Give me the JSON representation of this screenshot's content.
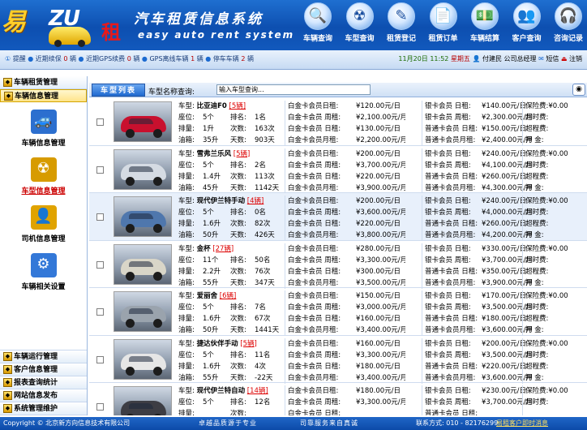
{
  "logo": {
    "script": "易",
    "latin": "ZU",
    "char": "租"
  },
  "app": {
    "title": "汽车租赁信息系统",
    "subtitle": "easy auto rent system"
  },
  "nav": [
    {
      "label": "车辆查询",
      "icon": "magnifier-icon",
      "glyph": "🔍"
    },
    {
      "label": "车型查询",
      "icon": "radiation-icon",
      "glyph": "☢"
    },
    {
      "label": "租赁登记",
      "icon": "pen-icon",
      "glyph": "✎"
    },
    {
      "label": "租赁订单",
      "icon": "document-icon",
      "glyph": "📄"
    },
    {
      "label": "车辆结算",
      "icon": "money-icon",
      "glyph": "💵"
    },
    {
      "label": "客户查询",
      "icon": "users-icon",
      "glyph": "👥"
    },
    {
      "label": "咨询记录",
      "icon": "headset-icon",
      "glyph": "🎧"
    }
  ],
  "status": {
    "remind": "提醒",
    "due": "近期续保",
    "due_n": "0",
    "due_u": "辆",
    "gps": "近期GPS续费",
    "gps_n": "0",
    "gps_u": "辆",
    "gpsoff": "GPS离线车辆",
    "gpsoff_n": "1",
    "gpsoff_u": "辆",
    "parked": "停车车辆",
    "parked_n": "2",
    "parked_u": "辆",
    "time": "11月20日 11:52",
    "weekday": "星期五",
    "user": "付建民 公司总经理",
    "sms": "短信",
    "logout": "注销"
  },
  "sidebar": {
    "top": [
      {
        "label": "车辆租赁管理"
      },
      {
        "label": "车辆信息管理",
        "active": true
      }
    ],
    "sub": [
      {
        "label": "车辆信息管理",
        "glyph": "🚙",
        "icon": "car-info-icon",
        "color": "#2c6fcf"
      },
      {
        "label": "车型信息管理",
        "glyph": "☢",
        "icon": "car-type-icon",
        "color": "#d79b00",
        "selected": true
      },
      {
        "label": "司机信息管理",
        "glyph": "👤",
        "icon": "driver-icon",
        "color": "#e0a300"
      },
      {
        "label": "车辆相关设置",
        "glyph": "⚙",
        "icon": "settings-icon",
        "color": "#3378d8"
      }
    ],
    "bottom": [
      {
        "label": "车辆运行管理"
      },
      {
        "label": "客户信息管理"
      },
      {
        "label": "报表查询统计"
      },
      {
        "label": "网站信息发布"
      },
      {
        "label": "系统管理维护"
      }
    ]
  },
  "toolbar": {
    "tab": "车型列表",
    "search_label": "车型名称查询:",
    "search_value": "输入车型查询..."
  },
  "labels": {
    "type": "车型:",
    "seat": "座位:",
    "rank": "排名:",
    "disp": "排量:",
    "times": "次数:",
    "tank": "油箱:",
    "days": "天数:",
    "gold_day": "白金卡会员日租:",
    "gold_wk": "白金卡会员 周租:",
    "gold_d": "白金卡会员 日租:",
    "gold_m": "白金卡会员月租:",
    "silver_day": "银卡会员 日租:",
    "silver_wk": "银卡会员 周租:",
    "norm_d": "普通卡会员 日租:",
    "norm_m": "普通卡会员月租:",
    "ins": "保险费:",
    "over1": "超时费:",
    "over2": "超程费:",
    "deposit": "押 金:"
  },
  "cars": [
    {
      "name": "比亚迪F0",
      "n": "[5辆]",
      "seat": "5个",
      "rank": "1名",
      "disp": "1升",
      "times": "163次",
      "tank": "35升",
      "days": "903天",
      "p": [
        "¥120.00元/日",
        "¥2,100.00元/月",
        "¥130.00元/日",
        "¥2,200.00元/月"
      ],
      "q": [
        "¥140.00元/日",
        "¥2,300.00元/月",
        "¥150.00元/日",
        "¥2,400.00元/月"
      ],
      "r": [
        "保险费:¥0.00",
        "超时费:",
        "超程费:",
        "押 金:"
      ],
      "color": "#c8102e"
    },
    {
      "name": "雪弗兰乐风",
      "n": "[5辆]",
      "seat": "5个",
      "rank": "2名",
      "disp": "1.4升",
      "times": "113次",
      "tank": "45升",
      "days": "1142天",
      "p": [
        "¥200.00元/日",
        "¥3,700.00元/月",
        "¥220.00元/日",
        "¥3,900.00元/月"
      ],
      "q": [
        "¥240.00元/日",
        "¥4,100.00元/月",
        "¥260.00元/日",
        "¥4,300.00元/月"
      ],
      "r": [
        "保险费:¥0.00",
        "超时费:",
        "超程费:",
        "押 金:"
      ],
      "color": "#d5dbe3"
    },
    {
      "name": "现代伊兰特手动",
      "n": "[4辆]",
      "seat": "5个",
      "rank": "0名",
      "disp": "1.6升",
      "times": "82次",
      "tank": "50升",
      "days": "426天",
      "p": [
        "¥200.00元/日",
        "¥3,600.00元/月",
        "¥220.00元/日",
        "¥3,800.00元/月"
      ],
      "q": [
        "¥240.00元/日",
        "¥4,000.00元/月",
        "¥260.00元/日",
        "¥4,200.00元/月"
      ],
      "r": [
        "保险费:¥0.00",
        "超时费:",
        "超程费:",
        "押 金:"
      ],
      "color": "#4f77ad",
      "hl": true
    },
    {
      "name": "金杯",
      "n": "[27辆]",
      "seat": "11个",
      "rank": "50名",
      "disp": "2.2升",
      "times": "76次",
      "tank": "55升",
      "days": "347天",
      "p": [
        "¥280.00元/日",
        "¥3,300.00元/月",
        "¥300.00元/日",
        "¥3,500.00元/月"
      ],
      "q": [
        "¥330.00元/日",
        "¥3,700.00元/月",
        "¥350.00元/日",
        "¥3,900.00元/月"
      ],
      "r": [
        "保险费:¥0.00",
        "超时费:",
        "超程费:",
        "押 金:"
      ],
      "color": "#d9d6c8"
    },
    {
      "name": "爱丽舍",
      "n": "[6辆]",
      "seat": "5个",
      "rank": "7名",
      "disp": "1.6升",
      "times": "67次",
      "tank": "50升",
      "days": "1441天",
      "p": [
        "¥150.00元/日",
        "¥3,000.00元/月",
        "¥160.00元/日",
        "¥3,400.00元/月"
      ],
      "q": [
        "¥170.00元/日",
        "¥3,500.00元/月",
        "¥180.00元/日",
        "¥3,600.00元/月"
      ],
      "r": [
        "保险费:¥0.00",
        "超时费:",
        "超程费:",
        "押 金:"
      ],
      "color": "#9aa3ad"
    },
    {
      "name": "捷达伙伴手动",
      "n": "[5辆]",
      "seat": "5个",
      "rank": "11名",
      "disp": "1.6升",
      "times": "4次",
      "tank": "55升",
      "days": "-22天",
      "p": [
        "¥160.00元/日",
        "¥3,300.00元/月",
        "¥180.00元/日",
        "¥3,400.00元/月"
      ],
      "q": [
        "¥200.00元/日",
        "¥3,500.00元/月",
        "¥220.00元/日",
        "¥3,600.00元/月"
      ],
      "r": [
        "保险费:¥0.00",
        "超时费:",
        "超程费:",
        "押 金:"
      ],
      "color": "#e6e6e6"
    },
    {
      "name": "现代伊兰特自动",
      "n": "[14辆]",
      "seat": "5个",
      "rank": "12名",
      "disp": "",
      "times": "",
      "tank": "",
      "days": "",
      "p": [
        "¥180.00元/日",
        "¥3,300.00元/月",
        "",
        ""
      ],
      "q": [
        "¥230.00元/日",
        "¥3,700.00元/月",
        "",
        ""
      ],
      "r": [
        "保险费:¥0.00",
        "超时费:",
        "",
        ""
      ],
      "color": "#3d3d44"
    }
  ],
  "footer": {
    "copy": "Copyright © 北京新方向信息技术有限公司",
    "s1": "卓越品质源于专业",
    "s2": "司靠服务来自真诚",
    "contact": "联系方式: 010 - 82176299",
    "msg": "易租客户即时消息"
  }
}
